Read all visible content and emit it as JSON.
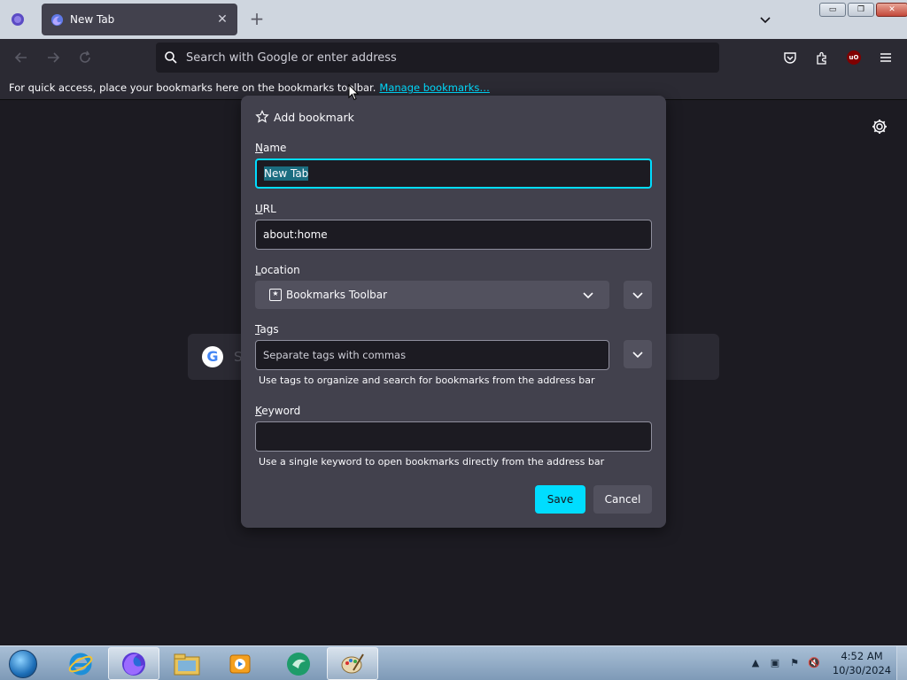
{
  "browser": {
    "tab": {
      "title": "New Tab",
      "close_glyph": "✕"
    },
    "new_tab_glyph": "+",
    "window_buttons": {
      "minimize": "▭",
      "restore": "❐",
      "close": "✕"
    },
    "urlbar": {
      "placeholder": "Search with Google or enter address"
    },
    "bookmarks_toolbar": {
      "message": "For quick access, place your bookmarks here on the bookmarks toolbar.",
      "link": "Manage bookmarks…"
    },
    "ublock_label": "uO"
  },
  "newtab": {
    "search_letter": "S",
    "google_letter": "G"
  },
  "dialog": {
    "title": "Add bookmark",
    "name": {
      "label_first": "N",
      "label_rest": "ame",
      "value": "New Tab"
    },
    "url": {
      "label_first": "U",
      "label_rest": "RL",
      "value": "about:home"
    },
    "location": {
      "label_first": "L",
      "label_rest": "ocation",
      "value": "Bookmarks Toolbar"
    },
    "tags": {
      "label_first": "T",
      "label_rest": "ags",
      "placeholder": "Separate tags with commas",
      "hint": "Use tags to organize and search for bookmarks from the address bar"
    },
    "keyword": {
      "label_first": "K",
      "label_rest": "eyword",
      "value": "",
      "hint": "Use a single keyword to open bookmarks directly from the address bar"
    },
    "save_label": "Save",
    "cancel_label": "Cancel"
  },
  "taskbar": {
    "apps": [
      "internet-explorer",
      "firefox",
      "file-explorer",
      "media-player",
      "app-green",
      "paint"
    ],
    "clock": {
      "time": "4:52 AM",
      "date": "10/30/2024"
    }
  },
  "colors": {
    "accent": "#00ddff",
    "dialog_bg": "#42414d",
    "field_bg": "#1c1b22",
    "toolbar_bg": "#2b2a33"
  }
}
